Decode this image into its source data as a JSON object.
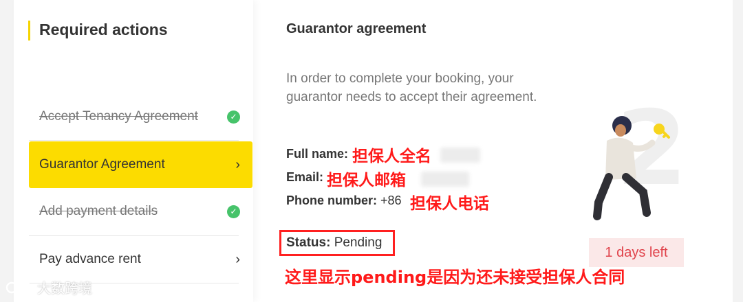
{
  "sidebar": {
    "title": "Required actions",
    "items": [
      {
        "label": "Accept Tenancy Agreement",
        "state": "done"
      },
      {
        "label": "Guarantor Agreement",
        "state": "active"
      },
      {
        "label": "Add payment details",
        "state": "done"
      },
      {
        "label": "Pay advance rent",
        "state": "pending"
      }
    ]
  },
  "main": {
    "title": "Guarantor agreement",
    "intro": "In order to complete your booking, your guarantor needs to accept their agreement.",
    "full_name_label": "Full name:",
    "full_name_note": "担保人全名",
    "email_label": "Email:",
    "email_note": "担保人邮箱",
    "phone_label": "Phone number:",
    "phone_prefix": "+86",
    "phone_note": "担保人电话",
    "status_label": "Status:",
    "status_value": "Pending",
    "status_note": "这里显示pending是因为还未接受担保人合同",
    "days_left": "1 days left"
  },
  "watermark": "大数跨境",
  "colors": {
    "accent_yellow": "#fcdc00",
    "check_green": "#46c36a",
    "annotation_red": "#ff1a1a",
    "days_left_bg": "#fbe8e8"
  },
  "icons": [
    "check-icon",
    "chevron-right-icon",
    "guarantor-illustration",
    "key-icon"
  ]
}
